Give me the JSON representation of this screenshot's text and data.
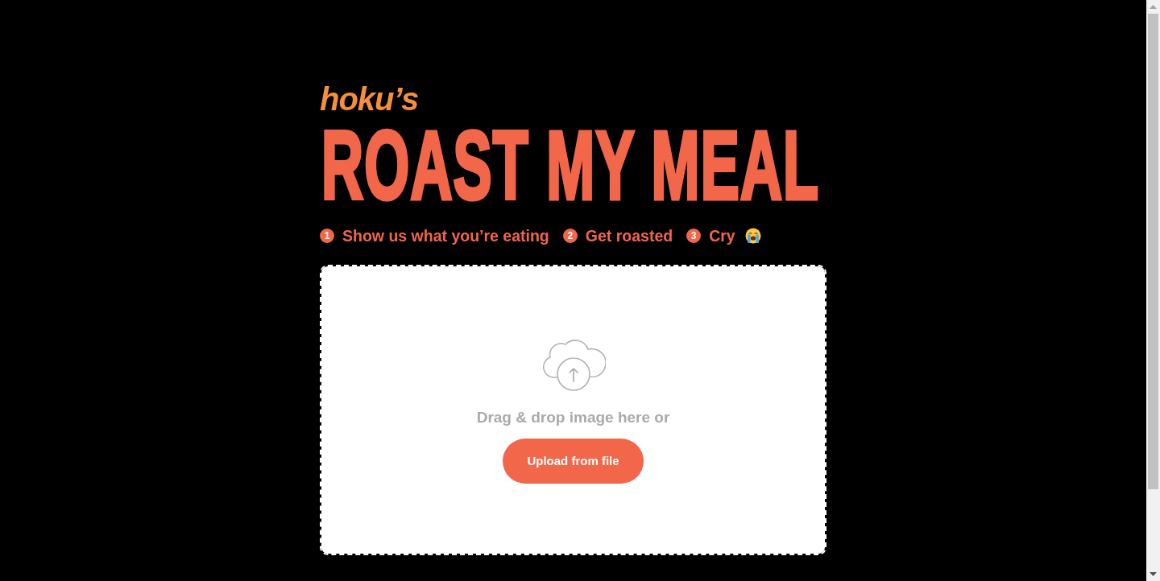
{
  "brand": {
    "prefix": "hoku’s",
    "title": "ROAST MY MEAL"
  },
  "steps": [
    {
      "number": "1",
      "label": "Show us what you’re eating",
      "has_icon": false
    },
    {
      "number": "2",
      "label": "Get roasted",
      "has_icon": false
    },
    {
      "number": "3",
      "label": "Cry",
      "has_icon": true
    }
  ],
  "upload": {
    "prompt": "Drag & drop image here or",
    "button": "Upload from file"
  }
}
